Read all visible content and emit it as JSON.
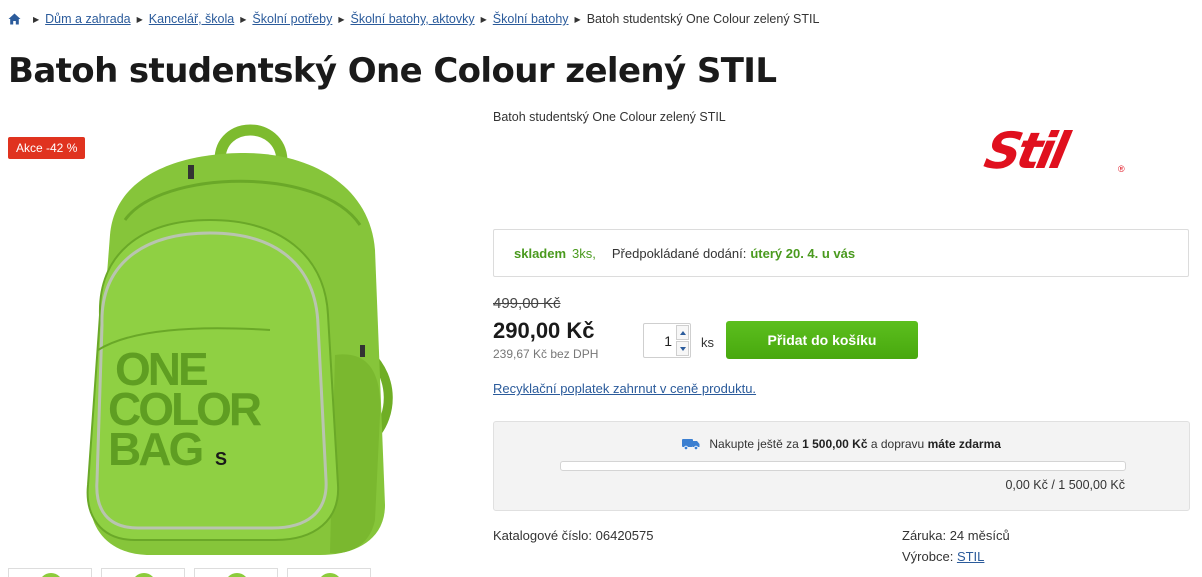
{
  "breadcrumb": {
    "items": [
      "Dům a zahrada",
      "Kancelář, škola",
      "Školní potřeby",
      "Školní batohy, aktovky",
      "Školní batohy"
    ],
    "current": "Batoh studentský One Colour zelený STIL"
  },
  "product": {
    "title": "Batoh studentský One Colour zelený STIL",
    "badge": "Akce -42 %",
    "short_description": "Batoh studentský One Colour zelený STIL",
    "image_text": [
      "ONE",
      "COLOR",
      "BAG"
    ],
    "image_mark": "S",
    "brand_logo_text": "Stil",
    "brand_logo_reg": "®",
    "stock": {
      "status": "skladem",
      "count": "3ks,",
      "delivery_label": "Předpokládané dodání:",
      "delivery_date": "úterý 20. 4. u vás"
    },
    "pricing": {
      "old_price": "499,00 Kč",
      "price": "290,00 Kč",
      "price_without_vat": "239,67 Kč bez DPH"
    },
    "quantity": {
      "value": "1",
      "unit": "ks"
    },
    "add_to_cart_label": "Přidat do košíku",
    "recycle_link": "Recyklační poplatek zahrnut v ceně produktu.",
    "shipping": {
      "text_prefix": "Nakupte ještě za",
      "amount": "1 500,00 Kč",
      "text_middle": "a dopravu",
      "text_bold": "máte zdarma",
      "progress_fraction": 0,
      "progress_text": "0,00 Kč / 1 500,00 Kč"
    },
    "details": {
      "catalog_label": "Katalogové číslo:",
      "catalog_value": "06420575",
      "warranty_label": "Záruka:",
      "warranty_value": "24 měsíců",
      "maker_label": "Výrobce:",
      "maker_value": "STIL"
    }
  },
  "colors": {
    "accent_green": "#5cbf1e",
    "link_blue": "#2b5b9b",
    "badge_red": "#e0331f",
    "bag_green": "#8ccc3c"
  },
  "icons": [
    "home-icon",
    "chevron-right-icon",
    "truck-icon",
    "arrow-up-icon",
    "arrow-down-icon"
  ]
}
